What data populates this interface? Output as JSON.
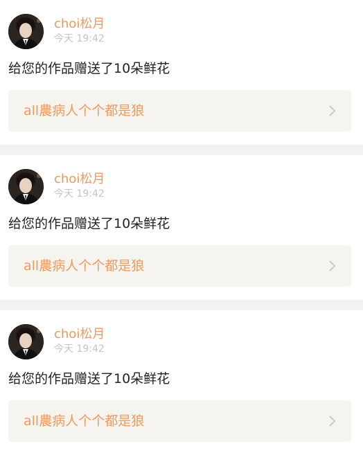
{
  "notifications": [
    {
      "username": "choi松月",
      "time": "今天 19:42",
      "message": "给您的作品赠送了10朵鲜花",
      "work_title": "all農病人个个都是狼"
    },
    {
      "username": "choi松月",
      "time": "今天 19:42",
      "message": "给您的作品赠送了10朵鲜花",
      "work_title": "all農病人个个都是狼"
    },
    {
      "username": "choi松月",
      "time": "今天 19:42",
      "message": "给您的作品赠送了10朵鲜花",
      "work_title": "all農病人个个都是狼"
    }
  ],
  "icons": {
    "avatar": "user-avatar-image",
    "chevron": "chevron-right-icon"
  },
  "colors": {
    "accent": "#ee9a5e",
    "timestamp": "#c4c4c4",
    "message": "#222222",
    "link_bg": "#f5f4ef",
    "separator": "#f2f2f2"
  }
}
